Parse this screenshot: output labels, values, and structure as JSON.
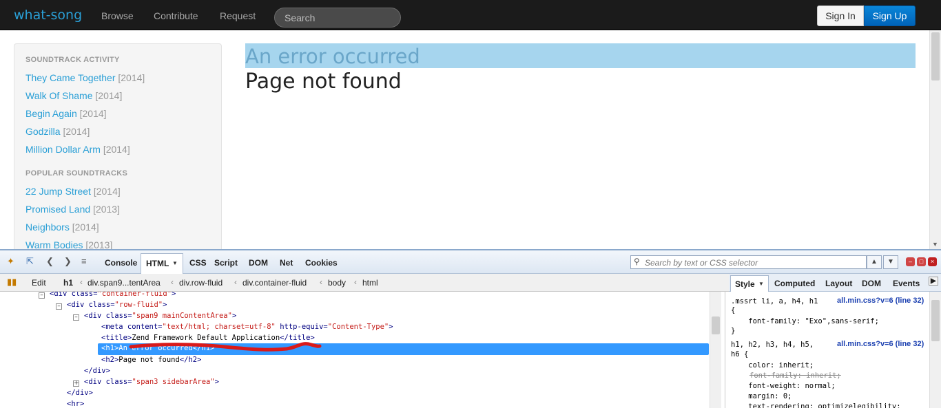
{
  "navbar": {
    "brand": "what-song",
    "links": [
      "Browse",
      "Contribute",
      "Request"
    ],
    "search_placeholder": "Search",
    "signin_label": "Sign In",
    "signup_label": "Sign Up"
  },
  "sidebar": {
    "activity_heading": "SOUNDTRACK ACTIVITY",
    "activity_items": [
      {
        "title": "They Came Together",
        "year": "[2014]"
      },
      {
        "title": "Walk Of Shame",
        "year": "[2014]"
      },
      {
        "title": "Begin Again",
        "year": "[2014]"
      },
      {
        "title": "Godzilla",
        "year": "[2014]"
      },
      {
        "title": "Million Dollar Arm",
        "year": "[2014]"
      }
    ],
    "popular_heading": "POPULAR SOUNDTRACKS",
    "popular_items": [
      {
        "title": "22 Jump Street",
        "year": "[2014]"
      },
      {
        "title": "Promised Land",
        "year": "[2013]"
      },
      {
        "title": "Neighbors",
        "year": "[2014]"
      },
      {
        "title": "Warm Bodies",
        "year": "[2013]"
      }
    ]
  },
  "main": {
    "error_title": "An error occurred",
    "error_subtitle": "Page not found"
  },
  "firebug": {
    "tabs": [
      "Console",
      "HTML",
      "CSS",
      "Script",
      "DOM",
      "Net",
      "Cookies"
    ],
    "search_placeholder": "Search by text or CSS selector",
    "edit_label": "Edit",
    "breadcrumbs": [
      "h1",
      "div.span9...tentArea",
      "div.row-fluid",
      "div.container-fluid",
      "body",
      "html"
    ],
    "side_tabs": [
      "Style",
      "Computed",
      "Layout",
      "DOM",
      "Events"
    ],
    "html_lines": {
      "l1_tag": "<div class=",
      "l1_val": "\"container-fluid\"",
      "l1_end": ">",
      "l2_tag": "<div class=",
      "l2_val": "\"row-fluid\"",
      "l2_end": ">",
      "l3_tag": "<div class=",
      "l3_val": "\"span9 mainContentArea\"",
      "l3_end": ">",
      "l4_a": "<meta content=",
      "l4_b": "\"text/html; charset=utf-8\"",
      "l4_c": " http-equiv=",
      "l4_d": "\"Content-Type\"",
      "l4_e": ">",
      "l5_a": "<title>",
      "l5_b": "Zend Framework Default Application",
      "l5_c": "</title>",
      "l6_a": "<h1>",
      "l6_b": "An error occurred",
      "l6_c": "</h1>",
      "l7_a": "<h2>",
      "l7_b": "Page not found",
      "l7_c": "</h2>",
      "l8": "</div>",
      "l9_tag": "<div class=",
      "l9_val": "\"span3 sidebarArea\"",
      "l9_end": ">",
      "l10": "</div>",
      "l11": "<hr>"
    },
    "style_rules": {
      "r1_selector": ".mssrt li, a, h4, h1",
      "r1_link": "all.min.css?v=6 (line 32)",
      "r1_open": "{",
      "r1_prop": "    font-family: \"Exo\",sans-serif;",
      "r1_close": "}",
      "r2_selector": "h1, h2, h3, h4, h5,",
      "r2_selector2": "h6 {",
      "r2_link": "all.min.css?v=6 (line 32)",
      "r2_p1": "    color: inherit;",
      "r2_p2": "font-family: inherit;",
      "r2_p3": "    font-weight: normal;",
      "r2_p4": "    margin: 0;",
      "r2_p5": "    text-rendering: optimizelegibility;"
    }
  }
}
